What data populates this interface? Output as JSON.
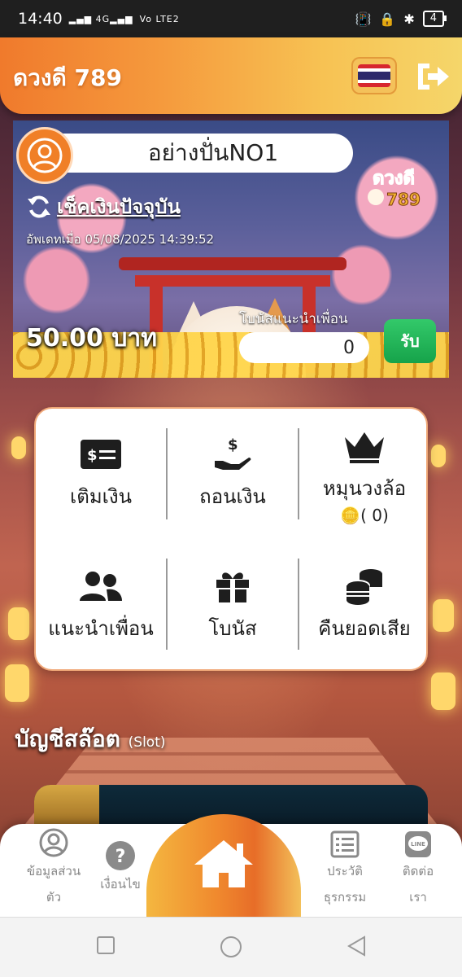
{
  "status_bar": {
    "time": "14:40",
    "signal_text": "4G",
    "volte": "Vo LTE2",
    "battery": "4"
  },
  "header": {
    "brand": "ดวงดี 789",
    "flag_icon": "thailand-flag-icon",
    "logout_icon": "logout-icon"
  },
  "banner": {
    "username": "อย่างปั่นNO1",
    "check_balance_label": "เช็คเงินปัจจุบัน",
    "updated_text": "อัพเดทเมื่อ 05/08/2025 14:39:52",
    "balance": "50.00 บาท",
    "referral_bonus_label": "โบนัสแนะนำเพื่อน",
    "referral_bonus_value": "0",
    "claim_label": "รับ",
    "logo_text": "ดวงดี 789"
  },
  "menu": {
    "items": [
      {
        "label": "เติมเงิน",
        "icon": "deposit-card-icon"
      },
      {
        "label": "ถอนเงิน",
        "icon": "withdraw-hand-icon"
      },
      {
        "label": "หมุนวงล้อ",
        "sub": "( 0)",
        "icon": "crown-icon"
      },
      {
        "label": "แนะนำเพื่อน",
        "icon": "friends-icon"
      },
      {
        "label": "โบนัส",
        "icon": "gift-icon"
      },
      {
        "label": "คืนยอดเสีย",
        "icon": "coins-stack-icon"
      }
    ]
  },
  "slot_section": {
    "title": "บัญชีสล๊อต",
    "subtitle": "(Slot)"
  },
  "bottom_nav": {
    "items": [
      {
        "label_line1": "ข้อมูลส่วน",
        "label_line2": "ตัว",
        "icon": "profile-icon"
      },
      {
        "label_line1": "เงื่อนไข",
        "icon": "help-icon"
      },
      {
        "icon": "home-icon"
      },
      {
        "label_line1": "ประวัติ",
        "label_line2": "ธุรกรรม",
        "icon": "history-list-icon"
      },
      {
        "label_line1": "ติดต่อ",
        "label_line2": "เรา",
        "icon": "line-chat-icon"
      }
    ]
  },
  "colors": {
    "header_gradient_start": "#f07a2c",
    "header_gradient_end": "#f5d66a",
    "claim_green": "#16a34a",
    "accent_orange": "#f07f27"
  }
}
